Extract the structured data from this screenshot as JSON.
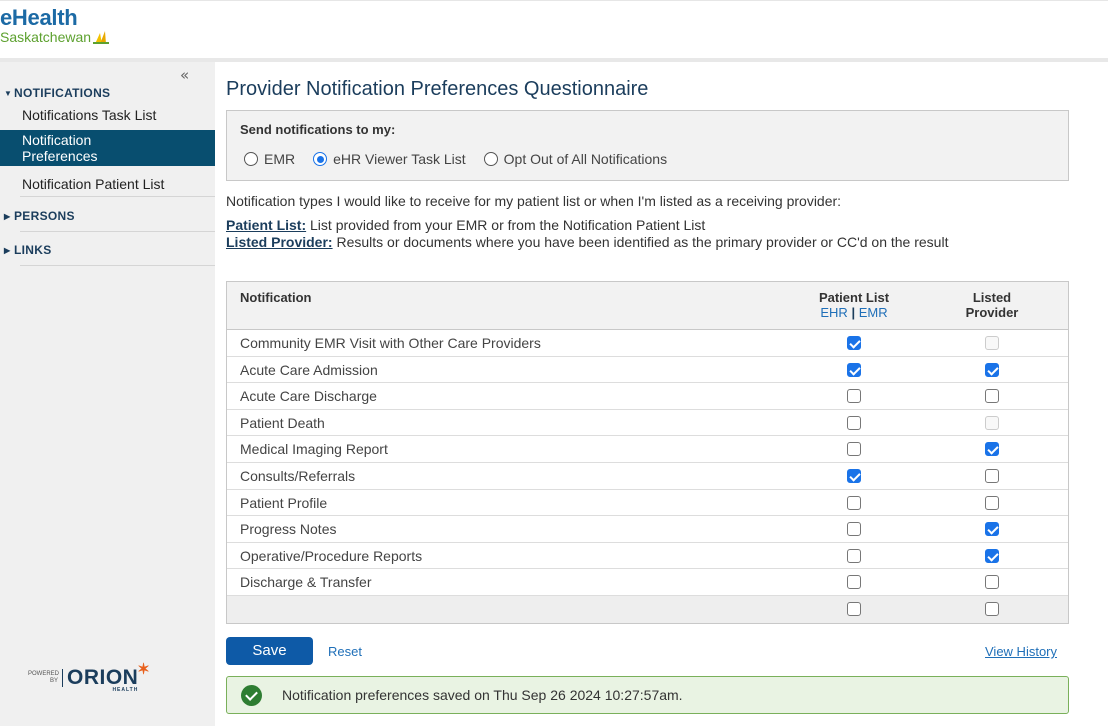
{
  "brand": {
    "name": "eHealth",
    "region": "Saskatchewan"
  },
  "sidebar": {
    "collapse_glyph": "«",
    "sections": [
      {
        "label": "NOTIFICATIONS",
        "expanded": true,
        "items": [
          {
            "label": "Notifications Task List",
            "active": false
          },
          {
            "label": "Notification Preferences",
            "active": true
          },
          {
            "label": "Notification Patient List",
            "active": false
          }
        ]
      },
      {
        "label": "PERSONS",
        "expanded": false
      },
      {
        "label": "LINKS",
        "expanded": false
      }
    ],
    "powered": {
      "small": "POWERED BY",
      "brand": "ORION",
      "sub": "HEALTH"
    }
  },
  "main": {
    "title": "Provider Notification Preferences Questionnaire",
    "send": {
      "label": "Send notifications to my:",
      "options": [
        {
          "label": "EMR",
          "checked": false
        },
        {
          "label": "eHR Viewer Task List",
          "checked": true
        },
        {
          "label": "Opt Out of All Notifications",
          "checked": false
        }
      ]
    },
    "intro": "Notification types I would like to receive for my patient list or when I'm listed as a receiving provider:",
    "definitions": [
      {
        "term": "Patient List:",
        "text": " List provided from your EMR or from the Notification Patient List"
      },
      {
        "term": "Listed Provider:",
        "text": " Results or documents where you have been identified as the primary provider or CC'd on the result"
      }
    ],
    "table": {
      "col_notification": "Notification",
      "col_patient_list": "Patient List",
      "col_patient_list_sub_a": "EHR",
      "col_patient_list_sub_sep": "|",
      "col_patient_list_sub_b": "EMR",
      "col_listed_1": "Listed",
      "col_listed_2": "Provider",
      "rows": [
        {
          "label": "Community EMR Visit with Other Care Providers",
          "patient_list": "checked",
          "listed_provider": "disabled"
        },
        {
          "label": "Acute Care Admission",
          "patient_list": "checked",
          "listed_provider": "checked"
        },
        {
          "label": "Acute Care Discharge",
          "patient_list": "unchecked",
          "listed_provider": "unchecked"
        },
        {
          "label": "Patient Death",
          "patient_list": "unchecked",
          "listed_provider": "disabled"
        },
        {
          "label": "Medical Imaging Report",
          "patient_list": "unchecked",
          "listed_provider": "checked"
        },
        {
          "label": "Consults/Referrals",
          "patient_list": "checked",
          "listed_provider": "unchecked"
        },
        {
          "label": "Patient Profile",
          "patient_list": "unchecked",
          "listed_provider": "unchecked"
        },
        {
          "label": "Progress Notes",
          "patient_list": "unchecked",
          "listed_provider": "checked"
        },
        {
          "label": "Operative/Procedure Reports",
          "patient_list": "unchecked",
          "listed_provider": "checked"
        },
        {
          "label": "Discharge & Transfer",
          "patient_list": "unchecked",
          "listed_provider": "unchecked"
        },
        {
          "label": "",
          "patient_list": "unchecked",
          "listed_provider": "unchecked"
        }
      ]
    },
    "actions": {
      "save": "Save",
      "reset": "Reset",
      "history": "View History"
    },
    "alert": {
      "text": "Notification preferences saved on Thu Sep 26 2024 10:27:57am.",
      "icon": "check-circle-icon",
      "color": "#2e7d32"
    }
  },
  "colors": {
    "accent": "#0e5aa7",
    "nav_active": "#084e6f",
    "title": "#1b3d5c",
    "checkbox": "#1a73e8"
  }
}
